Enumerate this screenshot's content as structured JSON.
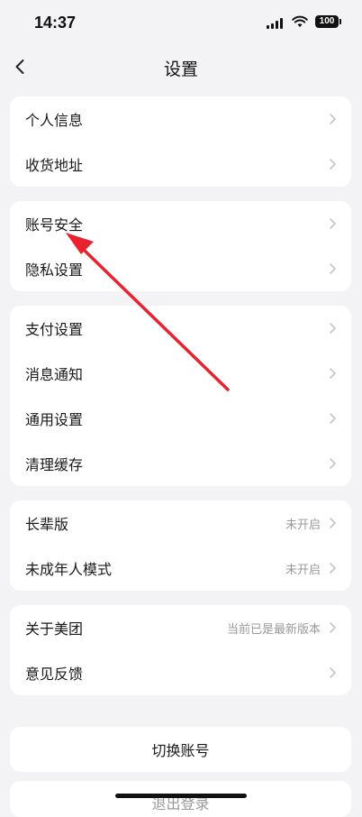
{
  "status": {
    "time": "14:37",
    "battery": "100"
  },
  "header": {
    "title": "设置"
  },
  "groups": [
    {
      "items": [
        {
          "label": "个人信息"
        },
        {
          "label": "收货地址"
        }
      ]
    },
    {
      "items": [
        {
          "label": "账号安全"
        },
        {
          "label": "隐私设置"
        }
      ]
    },
    {
      "items": [
        {
          "label": "支付设置"
        },
        {
          "label": "消息通知"
        },
        {
          "label": "通用设置"
        },
        {
          "label": "清理缓存"
        }
      ]
    },
    {
      "items": [
        {
          "label": "长辈版",
          "value": "未开启"
        },
        {
          "label": "未成年人模式",
          "value": "未开启"
        }
      ]
    },
    {
      "items": [
        {
          "label": "关于美团",
          "value": "当前已是最新版本"
        },
        {
          "label": "意见反馈"
        }
      ]
    }
  ],
  "actions": {
    "switch_account": "切换账号",
    "logout": "退出登录"
  },
  "colors": {
    "background": "#f3f3f5",
    "card": "#ffffff",
    "chevron": "#c4c4c4",
    "annotation_arrow": "#e8222e"
  }
}
